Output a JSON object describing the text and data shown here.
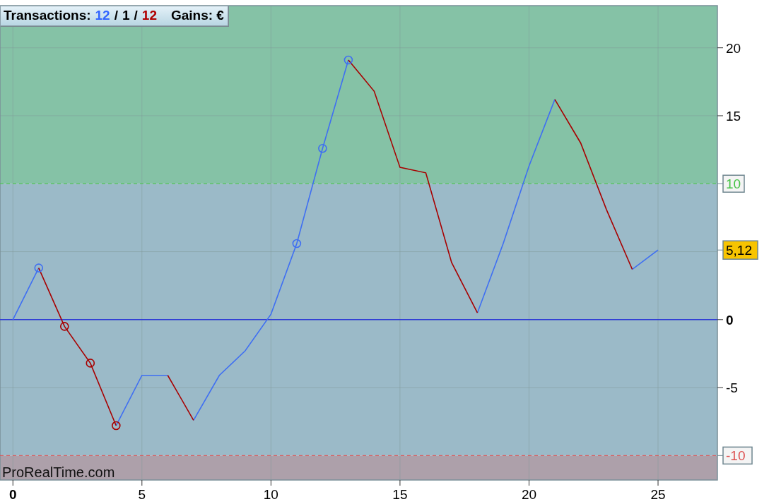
{
  "header": {
    "label": "Transactions:",
    "parts": [
      {
        "text": "12",
        "color": "#3366ff"
      },
      {
        "text": "/",
        "color": "#000000"
      },
      {
        "text": "1",
        "color": "#000000"
      },
      {
        "text": "/",
        "color": "#000000"
      },
      {
        "text": "12",
        "color": "#b00000"
      }
    ],
    "gains": "Gains: €"
  },
  "chart_data": {
    "type": "line",
    "x": [
      0,
      1,
      2,
      3,
      4,
      5,
      6,
      7,
      8,
      9,
      10,
      11,
      12,
      13,
      14,
      15,
      16,
      17,
      18,
      19,
      20,
      21,
      22,
      23,
      24,
      25
    ],
    "series": [
      {
        "color": "#3f6ff2",
        "values": [
          0,
          3.8,
          null,
          null,
          null,
          null,
          null,
          -7.4,
          -4.1,
          -2.3,
          0.4,
          5.6,
          12.6,
          19.1,
          null,
          null,
          null,
          null,
          null,
          null,
          null,
          null,
          null,
          null,
          3.7,
          5.12
        ]
      },
      {
        "color": "#3f6ff2",
        "values": [
          null,
          null,
          null,
          null,
          -7.8,
          -4.1,
          -4.1,
          null,
          null,
          null,
          null,
          null,
          null,
          null,
          null,
          null,
          null,
          null,
          0.5,
          5.6,
          11.3,
          16.2,
          null,
          null,
          null,
          null
        ]
      },
      {
        "color": "#a80000",
        "values": [
          null,
          3.8,
          -0.5,
          -3.2,
          -7.8,
          null,
          -4.1,
          -7.4,
          null,
          null,
          null,
          null,
          null,
          19.1,
          16.8,
          11.2,
          10.8,
          4.2,
          0.5,
          null,
          null,
          16.2,
          13.0,
          8.1,
          3.7,
          null
        ]
      },
      {
        "type": "scatter",
        "color": "#3f6ff2",
        "values": [
          null,
          3.8,
          null,
          null,
          null,
          null,
          null,
          null,
          null,
          null,
          null,
          5.6,
          12.6,
          19.1,
          null,
          null,
          null,
          null,
          null,
          null,
          null,
          null,
          null,
          null,
          null,
          null
        ]
      },
      {
        "type": "scatter",
        "color": "#a80000",
        "values": [
          null,
          null,
          -0.5,
          -3.2,
          -7.8,
          null,
          null,
          null,
          null,
          null,
          null,
          null,
          null,
          null,
          null,
          null,
          null,
          null,
          null,
          null,
          null,
          null,
          null,
          null,
          null,
          null
        ]
      }
    ],
    "xlim": [
      -0.5,
      27.3
    ],
    "ylim": [
      -11.8,
      23.1
    ],
    "xticks": [
      0,
      5,
      10,
      15,
      20,
      25
    ],
    "yticks": [
      -5,
      0,
      15,
      20
    ],
    "grid": true,
    "bands": [
      {
        "axis": "y",
        "from": 10,
        "to": 23.1,
        "color": "#85c2a6"
      },
      {
        "axis": "y",
        "from": -10,
        "to": 10,
        "color": "#9bbac8"
      },
      {
        "axis": "y",
        "from": -11.8,
        "to": -10,
        "color": "#ada0aa"
      }
    ],
    "ref_lines": [
      {
        "axis": "y",
        "value": 0,
        "color": "#2d3ad6"
      },
      {
        "axis": "y",
        "value": 10,
        "color": "#44c244",
        "label": "10"
      },
      {
        "axis": "y",
        "value": -10,
        "color": "#dd5050",
        "label": "-10"
      }
    ],
    "annotations": [
      "5,12"
    ]
  },
  "branding": "ProRealTime.com"
}
